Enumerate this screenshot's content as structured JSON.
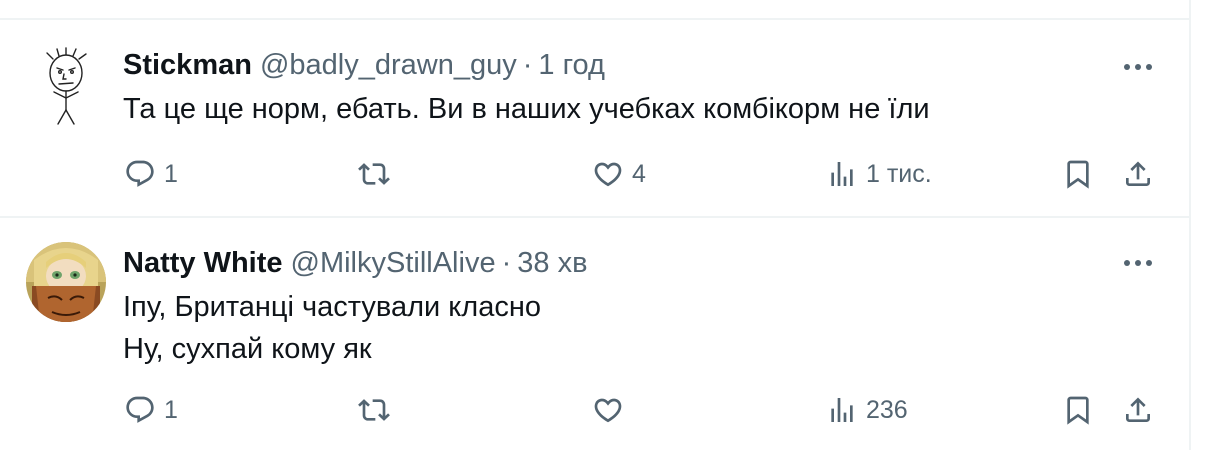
{
  "posts": [
    {
      "display_name": "Stickman",
      "handle": "@badly_drawn_guy",
      "separator": "·",
      "time": "1 год",
      "lines": [
        "Та це ще норм, ебать. Ви в наших учебках комбікорм не їли"
      ],
      "replies": "1",
      "reposts": "",
      "likes": "4",
      "views": "1 тис."
    },
    {
      "display_name": "Natty White",
      "handle": "@MilkyStillAlive",
      "separator": "·",
      "time": "38 хв",
      "lines": [
        "Іпу, Британці частували класно",
        "Ну, сухпай кому як"
      ],
      "replies": "1",
      "reposts": "",
      "likes": "",
      "views": "236"
    }
  ],
  "icons": {
    "reply": "reply-icon",
    "repost": "repost-icon",
    "like": "heart-icon",
    "views": "views-icon",
    "bookmark": "bookmark-icon",
    "share": "share-icon",
    "more": "more-icon"
  },
  "colors": {
    "text": "#0f1419",
    "secondary": "#536471",
    "border": "#eff3f4"
  }
}
